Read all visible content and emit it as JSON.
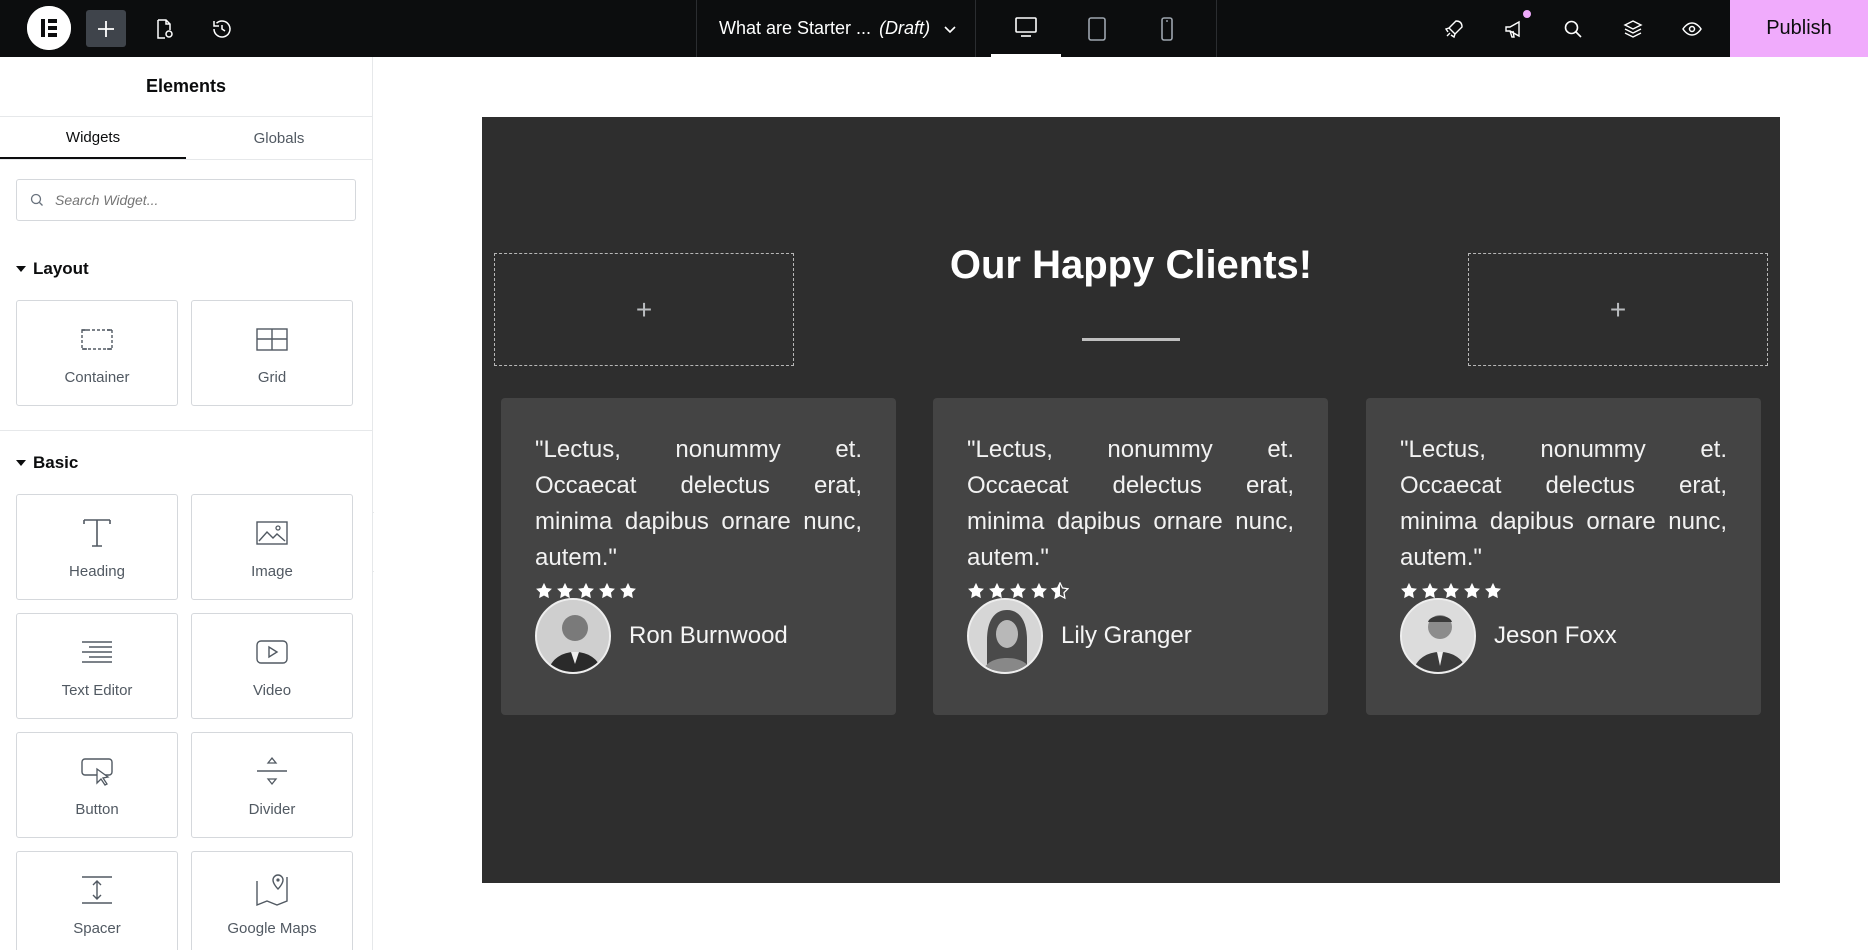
{
  "topbar": {
    "doc_title": "What are Starter ...",
    "doc_status": "(Draft)",
    "publish_label": "Publish",
    "accent_color": "#f0abfc"
  },
  "sidebar": {
    "title": "Elements",
    "tabs": [
      {
        "label": "Widgets",
        "active": true
      },
      {
        "label": "Globals",
        "active": false
      }
    ],
    "search_placeholder": "Search Widget...",
    "categories": {
      "layout": {
        "label": "Layout",
        "widgets": [
          {
            "label": "Container",
            "icon": "container-icon"
          },
          {
            "label": "Grid",
            "icon": "grid-icon"
          }
        ]
      },
      "basic": {
        "label": "Basic",
        "widgets": [
          {
            "label": "Heading",
            "icon": "heading-icon"
          },
          {
            "label": "Image",
            "icon": "image-icon"
          },
          {
            "label": "Text Editor",
            "icon": "text-editor-icon"
          },
          {
            "label": "Video",
            "icon": "video-icon"
          },
          {
            "label": "Button",
            "icon": "button-icon"
          },
          {
            "label": "Divider",
            "icon": "divider-icon"
          },
          {
            "label": "Spacer",
            "icon": "spacer-icon"
          },
          {
            "label": "Google Maps",
            "icon": "google-maps-icon"
          }
        ]
      }
    }
  },
  "canvas": {
    "heading": "Our Happy Clients!",
    "add_symbol": "+",
    "testimonials": [
      {
        "quote": "\"Lectus, nonummy et. Occaecat delectus erat, minima dapibus ornare nunc, autem.\"",
        "rating": 5,
        "name": "Ron Burnwood"
      },
      {
        "quote": "\"Lectus, nonummy et. Occaecat delectus erat, minima dapibus ornare nunc, autem.\"",
        "rating": 4.5,
        "name": "Lily Granger"
      },
      {
        "quote": "\"Lectus, nonummy et. Occaecat delectus erat, minima dapibus ornare nunc, autem.\"",
        "rating": 5,
        "name": "Jeson Foxx"
      }
    ]
  }
}
